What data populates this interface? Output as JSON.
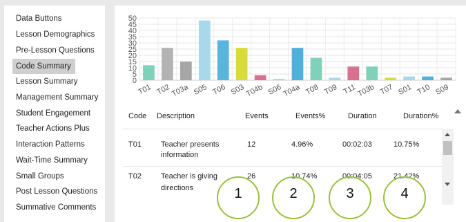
{
  "sidebar": {
    "items": [
      {
        "label": "Data Buttons",
        "active": false
      },
      {
        "label": "Lesson Demographics",
        "active": false
      },
      {
        "label": "Pre-Lesson Questions",
        "active": false
      },
      {
        "label": "Code Summary",
        "active": true
      },
      {
        "label": "Lesson Summary",
        "active": false
      },
      {
        "label": "Management Summary",
        "active": false
      },
      {
        "label": "Student Engagement",
        "active": false
      },
      {
        "label": "Teacher Actions Plus",
        "active": false
      },
      {
        "label": "Interaction Patterns",
        "active": false
      },
      {
        "label": "Wait-Time Summary",
        "active": false
      },
      {
        "label": "Small Groups",
        "active": false
      },
      {
        "label": "Post Lesson Questions",
        "active": false
      },
      {
        "label": "Summative Comments",
        "active": false
      }
    ]
  },
  "chart_data": {
    "type": "bar",
    "categories": [
      "T01",
      "T02",
      "T03a",
      "S05",
      "T06",
      "S03",
      "T04b",
      "S06",
      "T04a",
      "T08",
      "T09",
      "T11",
      "T03b",
      "T07",
      "S01",
      "T10",
      "S09"
    ],
    "values": [
      12,
      26,
      15,
      48,
      32,
      26,
      4,
      1,
      26,
      18,
      2,
      11,
      11,
      2,
      3,
      3,
      2
    ],
    "colors": [
      "#7fd1b9",
      "#b3b3b3",
      "#a6a6a6",
      "#a8d8ea",
      "#5ab4dc",
      "#d7dc3a",
      "#d8708f",
      "#9fd8e8",
      "#4fb0dc",
      "#7fd1b9",
      "#a8d8ea",
      "#d8708f",
      "#7fd1b9",
      "#d7dc3a",
      "#a8d8ea",
      "#4fb0dc",
      "#a6a6a6"
    ],
    "yticks": [
      0,
      5,
      10,
      15,
      20,
      25,
      30,
      35,
      40,
      45,
      50
    ],
    "ylim": [
      0,
      50
    ],
    "grid": true
  },
  "table": {
    "columns": [
      "Code",
      "Description",
      "Events",
      "Events%",
      "Duration",
      "Duration%"
    ],
    "rows": [
      {
        "code": "T01",
        "desc1": "Teacher presents",
        "desc2": "information",
        "events": "12",
        "events_pct": "4.96%",
        "duration": "00:02:03",
        "duration_pct": "10.75%"
      },
      {
        "code": "T02",
        "desc1": "Teacher is giving",
        "desc2": "directions",
        "events": "26",
        "events_pct": "10.74%",
        "duration": "00:04:05",
        "duration_pct": "21.42%"
      }
    ]
  },
  "callouts": [
    "1",
    "2",
    "3",
    "4"
  ],
  "icons": {
    "scroll_up": "triangle-up-icon",
    "scroll_down": "triangle-down-icon"
  }
}
